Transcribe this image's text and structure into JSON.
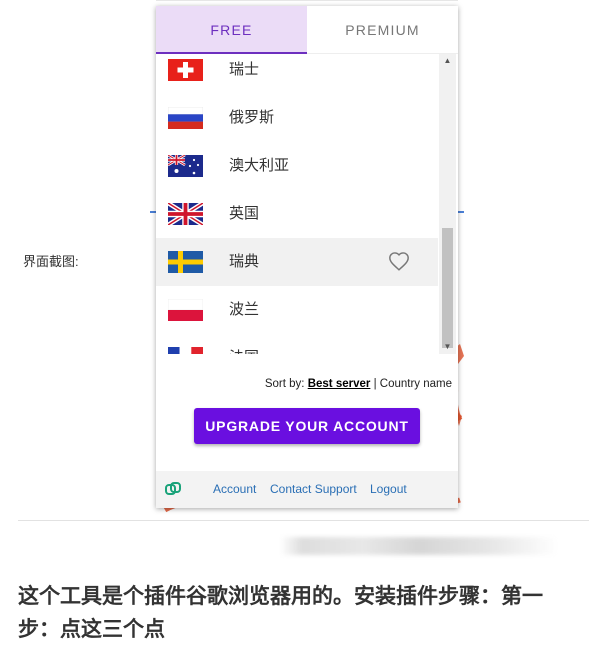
{
  "tabs": {
    "free": "FREE",
    "premium": "PREMIUM"
  },
  "countries": [
    {
      "name": "瑞士",
      "flag": "switzerland-flag"
    },
    {
      "name": "俄罗斯",
      "flag": "russia-flag"
    },
    {
      "name": "澳大利亚",
      "flag": "australia-flag"
    },
    {
      "name": "英国",
      "flag": "uk-flag"
    },
    {
      "name": "瑞典",
      "flag": "sweden-flag"
    },
    {
      "name": "波兰",
      "flag": "poland-flag"
    },
    {
      "name": "法国",
      "flag": "france-flag"
    }
  ],
  "sort": {
    "prefix": "Sort by:",
    "active": "Best server",
    "separator": "|",
    "other": "Country name"
  },
  "upgrade_label": "UPGRADE YOUR ACCOUNT",
  "footer": {
    "account": "Account",
    "support": "Contact Support",
    "logout": "Logout"
  },
  "article": {
    "screenshot_label": "界面截图:",
    "text": "这个工具是个插件谷歌浏览器用的。安装插件步骤：第一步：点这三个点"
  },
  "colors": {
    "accent": "#6a0fe0",
    "tab_active_bg": "#ebdcf7",
    "link": "#2a6fb5"
  }
}
